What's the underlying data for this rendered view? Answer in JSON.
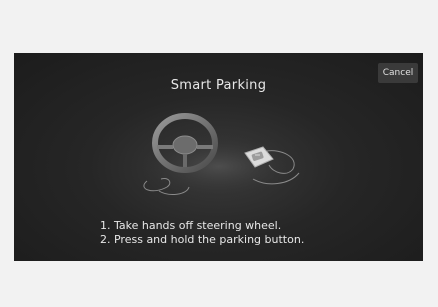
{
  "dialog": {
    "title": "Smart Parking",
    "cancel_label": "Cancel"
  },
  "instructions": [
    "1. Take hands off steering wheel.",
    "2. Press and hold the parking button."
  ],
  "illustration": {
    "icons": [
      "steering-wheel-icon",
      "parking-button-icon"
    ]
  },
  "colors": {
    "screen_background": "#1f1f1f",
    "text": "#e8e8e8",
    "page_background": "#f2f2f2"
  }
}
